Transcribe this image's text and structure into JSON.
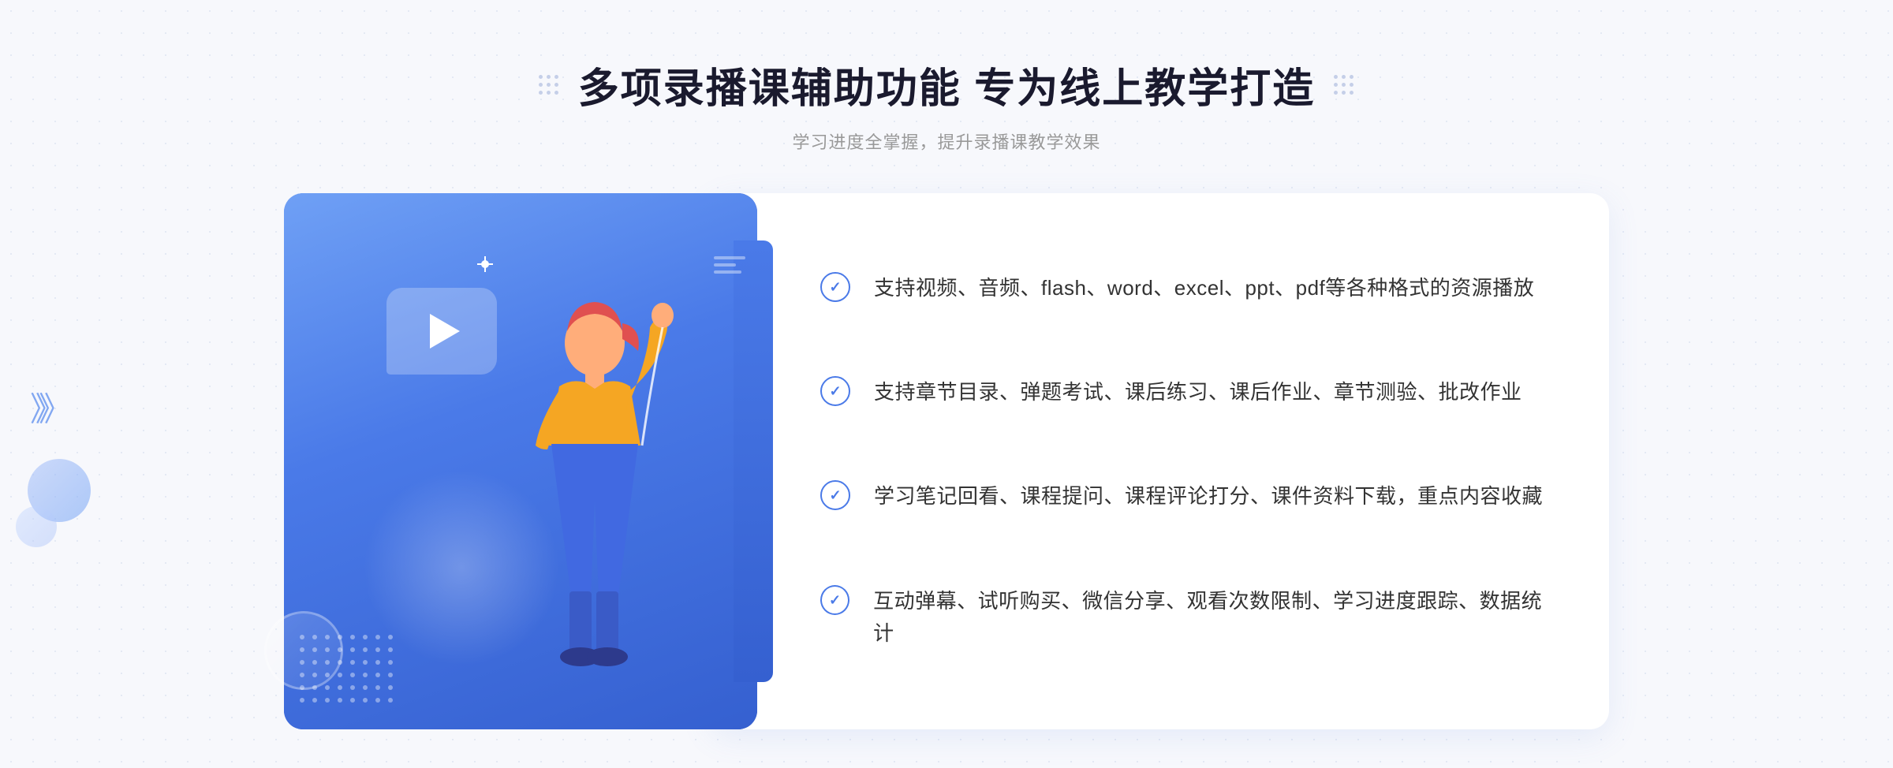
{
  "header": {
    "title": "多项录播课辅助功能 专为线上教学打造",
    "subtitle": "学习进度全掌握，提升录播课教学效果",
    "dot_grid_count": 9
  },
  "features": [
    {
      "id": "feature-1",
      "text": "支持视频、音频、flash、word、excel、ppt、pdf等各种格式的资源播放"
    },
    {
      "id": "feature-2",
      "text": "支持章节目录、弹题考试、课后练习、课后作业、章节测验、批改作业"
    },
    {
      "id": "feature-3",
      "text": "学习笔记回看、课程提问、课程评论打分、课件资料下载，重点内容收藏"
    },
    {
      "id": "feature-4",
      "text": "互动弹幕、试听购买、微信分享、观看次数限制、学习进度跟踪、数据统计"
    }
  ],
  "colors": {
    "primary_blue": "#4a7ae8",
    "dark_blue": "#3560d0",
    "light_blue": "#6fa0f5",
    "text_dark": "#1a1a2e",
    "text_gray": "#999999",
    "text_body": "#333333",
    "bg": "#f7f8fc"
  },
  "icons": {
    "check": "check-circle-icon",
    "play": "play-icon",
    "chevron": "chevron-right-icon"
  }
}
